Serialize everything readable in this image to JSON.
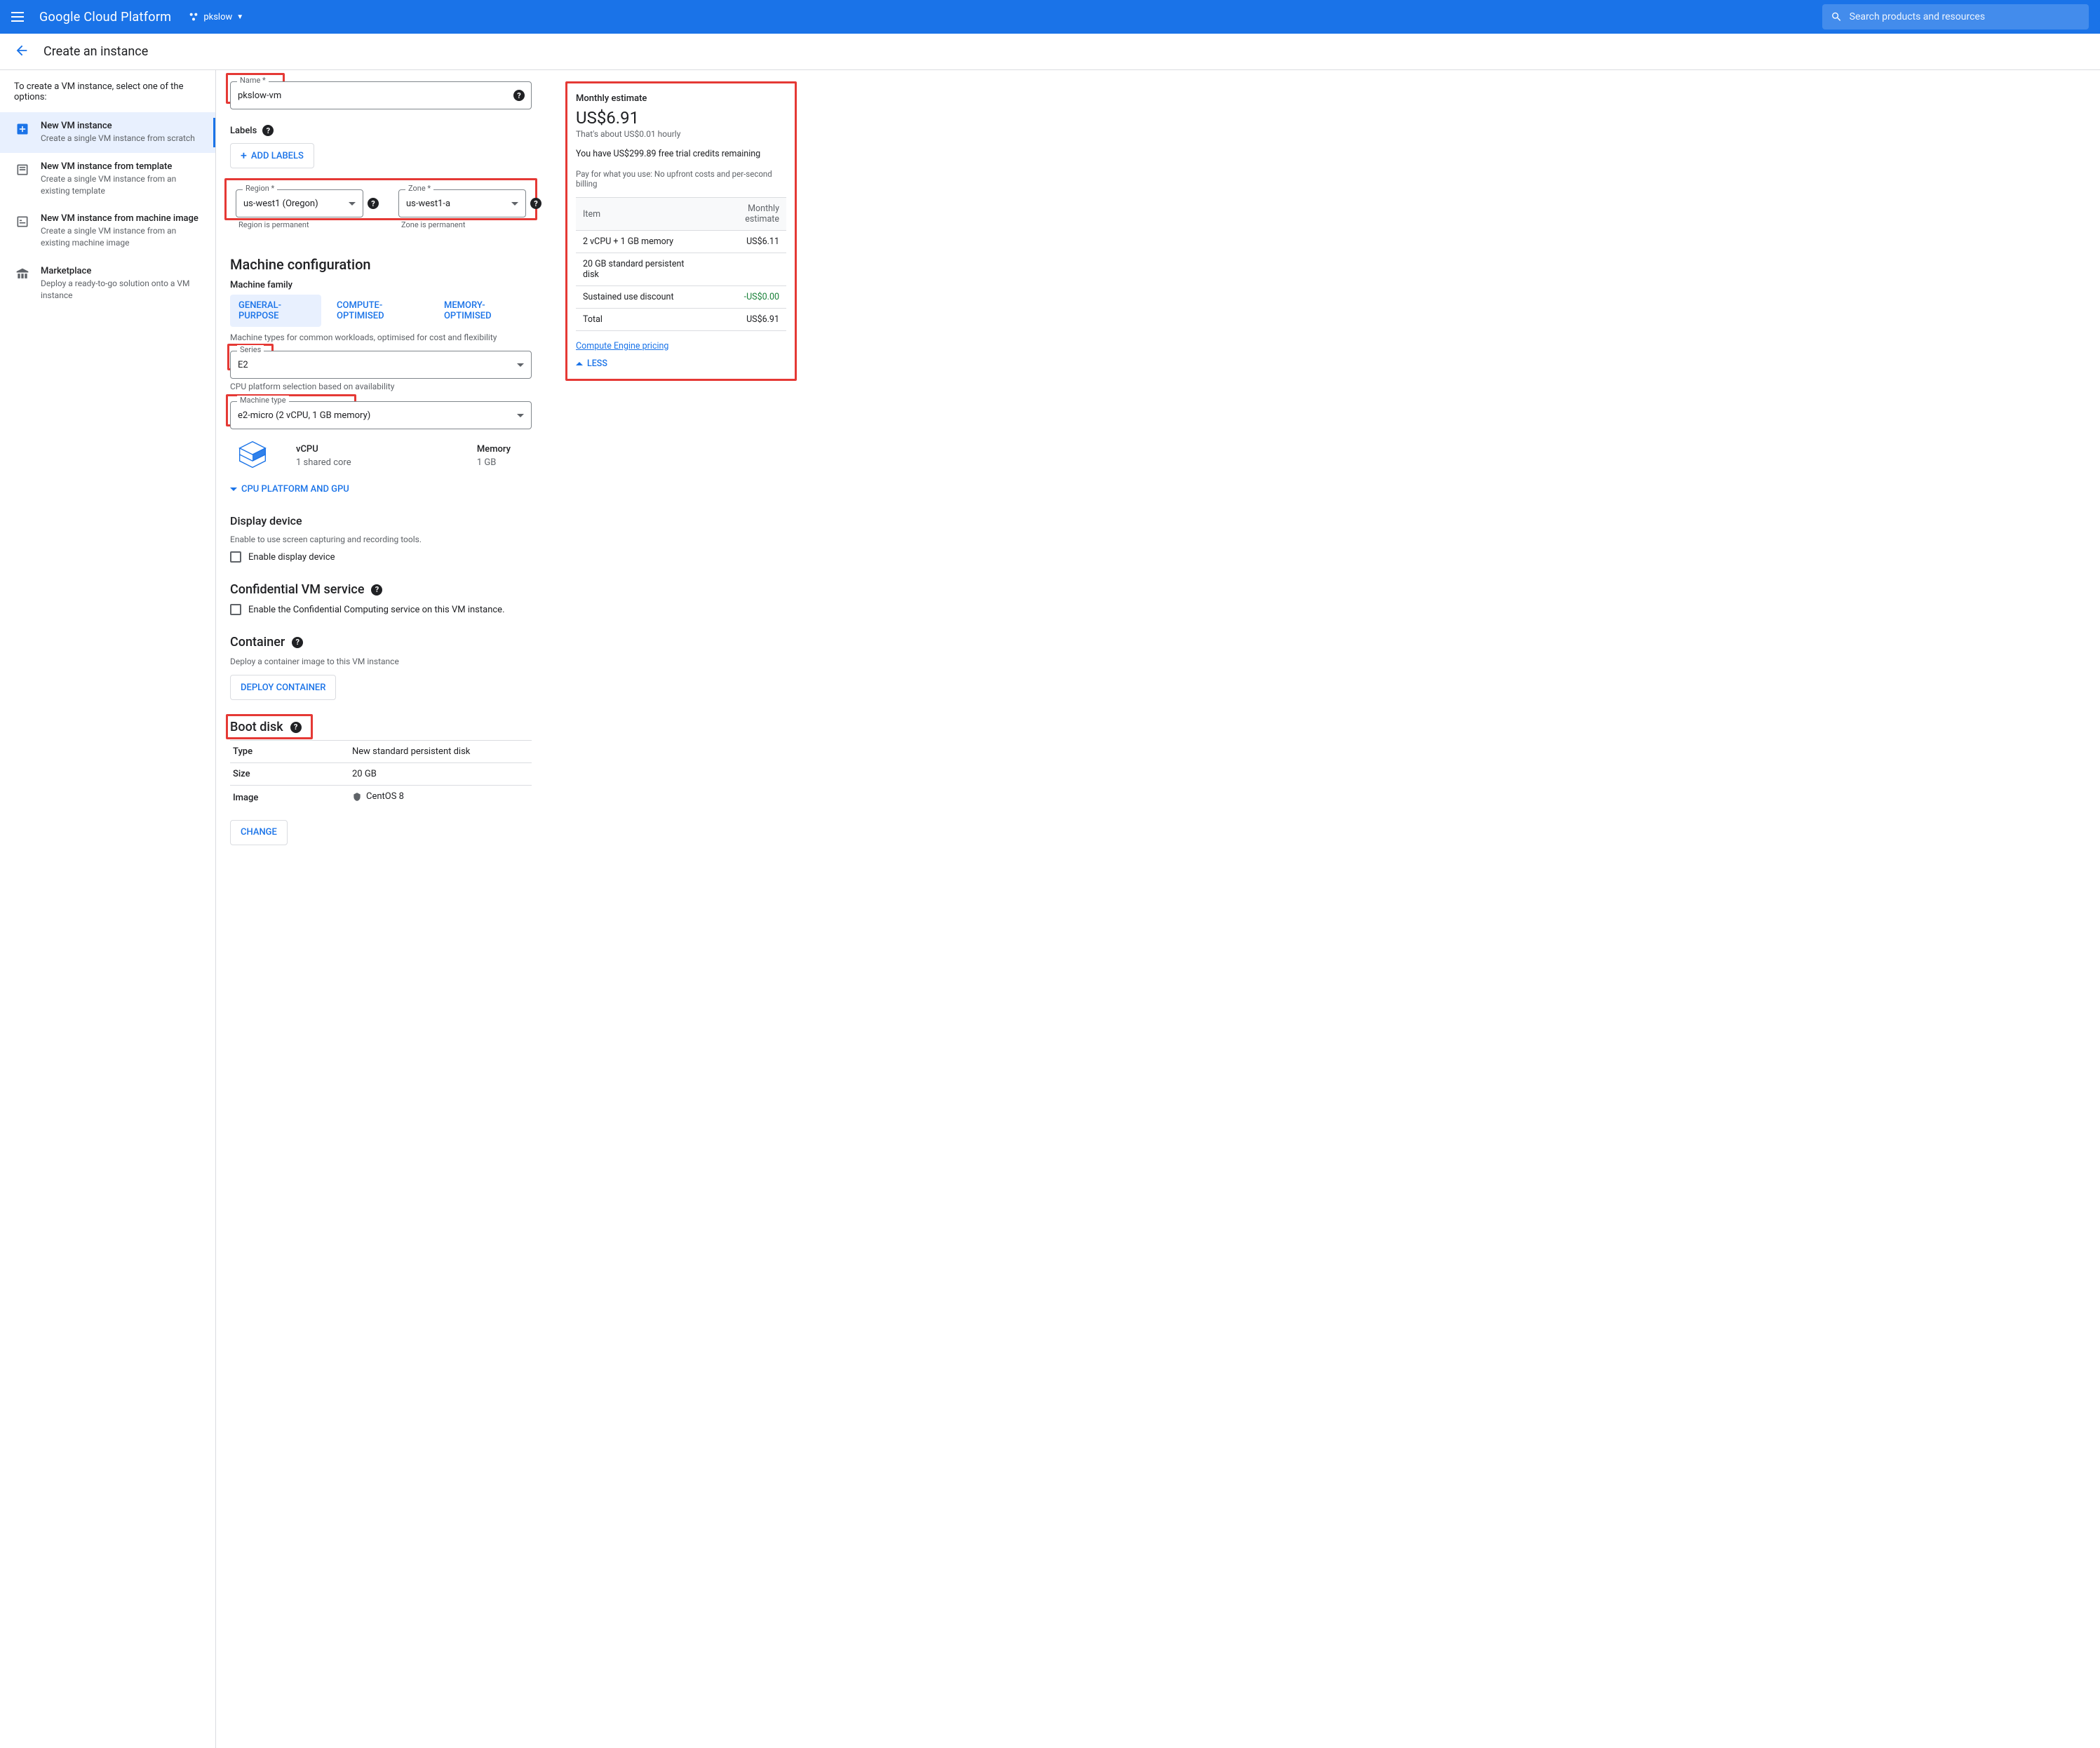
{
  "topbar": {
    "brand": "Google Cloud Platform",
    "project": "pkslow",
    "search_placeholder": "Search products and resources"
  },
  "subhead": {
    "title": "Create an instance"
  },
  "sidebar": {
    "hint": "To create a VM instance, select one of the options:",
    "items": [
      {
        "title": "New VM instance",
        "sub": "Create a single VM instance from scratch"
      },
      {
        "title": "New VM instance from template",
        "sub": "Create a single VM instance from an existing template"
      },
      {
        "title": "New VM instance from machine image",
        "sub": "Create a single VM instance from an existing machine image"
      },
      {
        "title": "Marketplace",
        "sub": "Deploy a ready-to-go solution onto a VM instance"
      }
    ]
  },
  "form": {
    "name_label": "Name *",
    "name_value": "pkslow-vm",
    "labels_label": "Labels",
    "add_labels_btn": "ADD LABELS",
    "region_label": "Region *",
    "region_value": "us-west1 (Oregon)",
    "region_hint": "Region is permanent",
    "zone_label": "Zone *",
    "zone_value": "us-west1-a",
    "zone_hint": "Zone is permanent",
    "machine_config_title": "Machine configuration",
    "machine_family_label": "Machine family",
    "tabs": [
      "GENERAL-PURPOSE",
      "COMPUTE-OPTIMISED",
      "MEMORY-OPTIMISED"
    ],
    "tab_hint": "Machine types for common workloads, optimised for cost and flexibility",
    "series_label": "Series",
    "series_value": "E2",
    "series_hint": "CPU platform selection based on availability",
    "machine_type_label": "Machine type",
    "machine_type_value": "e2-micro (2 vCPU, 1 GB memory)",
    "summary": {
      "vcpu_label": "vCPU",
      "vcpu_value": "1 shared core",
      "mem_label": "Memory",
      "mem_value": "1 GB"
    },
    "cpu_gpu_link": "CPU PLATFORM AND GPU",
    "display_title": "Display device",
    "display_hint": "Enable to use screen capturing and recording tools.",
    "display_checkbox": "Enable display device",
    "confidential_title": "Confidential VM service",
    "confidential_checkbox": "Enable the Confidential Computing service on this VM instance.",
    "container_title": "Container",
    "container_hint": "Deploy a container image to this VM instance",
    "deploy_container_btn": "DEPLOY CONTAINER",
    "boot_disk_title": "Boot disk",
    "boot_disk": {
      "type_label": "Type",
      "type_value": "New standard persistent disk",
      "size_label": "Size",
      "size_value": "20 GB",
      "image_label": "Image",
      "image_value": "CentOS 8"
    },
    "change_btn": "CHANGE"
  },
  "estimate": {
    "title": "Monthly estimate",
    "price": "US$6.91",
    "hourly": "That's about US$0.01 hourly",
    "credits": "You have US$299.89 free trial credits remaining",
    "payline": "Pay for what you use: No upfront costs and per-second billing",
    "table": {
      "header_item": "Item",
      "header_est": "Monthly estimate",
      "rows": [
        {
          "item": "2 vCPU + 1 GB memory",
          "est": "US$6.11"
        },
        {
          "item": "20 GB standard persistent disk",
          "est": ""
        },
        {
          "item": "Sustained use discount",
          "est": "-US$0.00",
          "discount": true
        },
        {
          "item": "Total",
          "est": "US$6.91"
        }
      ]
    },
    "pricing_link": "Compute Engine pricing",
    "less": "LESS"
  }
}
